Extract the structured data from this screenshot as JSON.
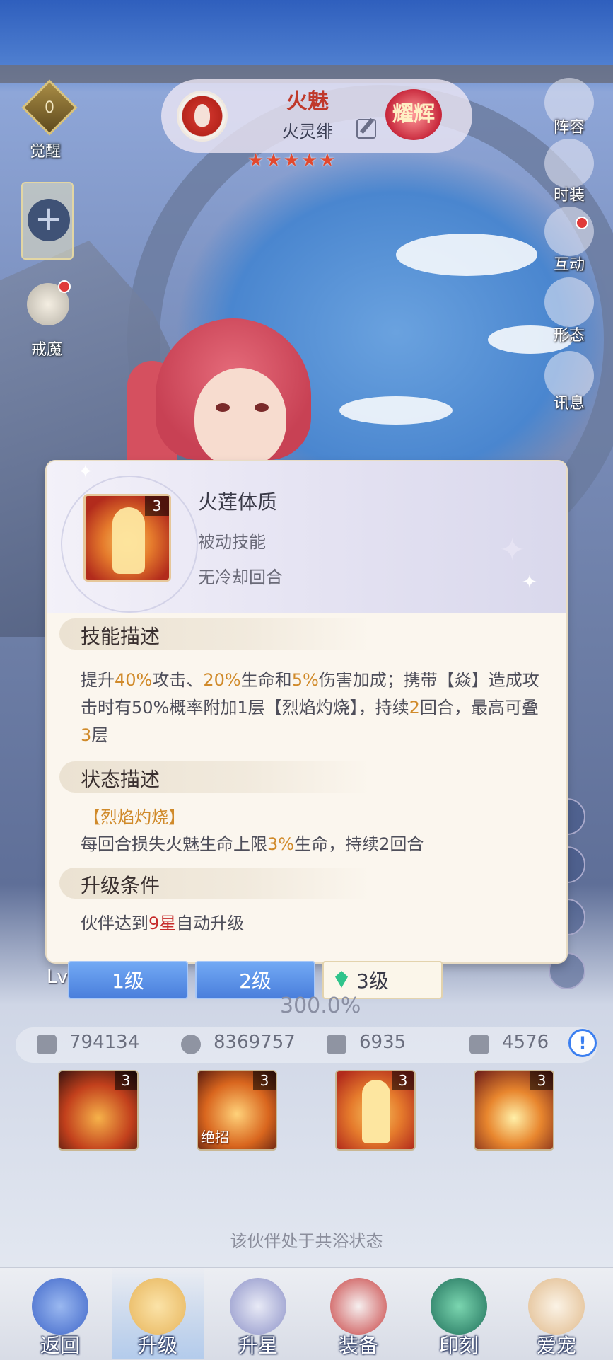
{
  "header": {
    "awaken_value": "0",
    "awaken_label": "觉醒",
    "jiemo_label": "戒魔",
    "character_name": "火魅",
    "character_subtitle": "火灵绯",
    "badge_text": "耀辉",
    "stars": "★★★★★"
  },
  "right_menu": [
    "阵容",
    "时装",
    "互动",
    "形态",
    "讯息"
  ],
  "skill_popup": {
    "level_badge": "3",
    "name": "火莲体质",
    "type": "被动技能",
    "cooldown": "无冷却回合",
    "section_desc": "技能描述",
    "desc": {
      "p1": "提升",
      "v1": "40%",
      "p2": "攻击、",
      "v2": "20%",
      "p3": "生命和",
      "v3": "5%",
      "p4": "伤害加成；携带【焱】造成攻击时有50%概率附加1层【烈焰灼烧】，持续",
      "v4": "2",
      "p5": "回合，最高可叠",
      "v5": "3",
      "p6": "层"
    },
    "section_status": "状态描述",
    "status_name": "【烈焰灼烧】",
    "status_p1": "每回合损失火魅生命上限",
    "status_v1": "3%",
    "status_p2": "生命，持续2回合",
    "section_upgrade": "升级条件",
    "upgrade_p1": "伙伴达到",
    "upgrade_v1": "9星",
    "upgrade_p2": "自动升级"
  },
  "level_tabs": [
    "1级",
    "2级",
    "3级"
  ],
  "lv_prefix": "Lv",
  "power": "300.0%",
  "stats": {
    "attack": "794134",
    "hp": "8369757",
    "defense": "6935",
    "speed": "4576",
    "info": "!"
  },
  "skills": [
    {
      "level": "3",
      "tag": ""
    },
    {
      "level": "3",
      "tag": "绝招"
    },
    {
      "level": "3",
      "tag": ""
    },
    {
      "level": "3",
      "tag": ""
    }
  ],
  "notice": "该伙伴处于共浴状态",
  "nav": [
    "返回",
    "升级",
    "升星",
    "装备",
    "印刻",
    "爱宠"
  ],
  "colors": {
    "highlight": "#d08a2a",
    "star_red": "#c62a2a",
    "tab_blue": "#4a7fdc"
  }
}
